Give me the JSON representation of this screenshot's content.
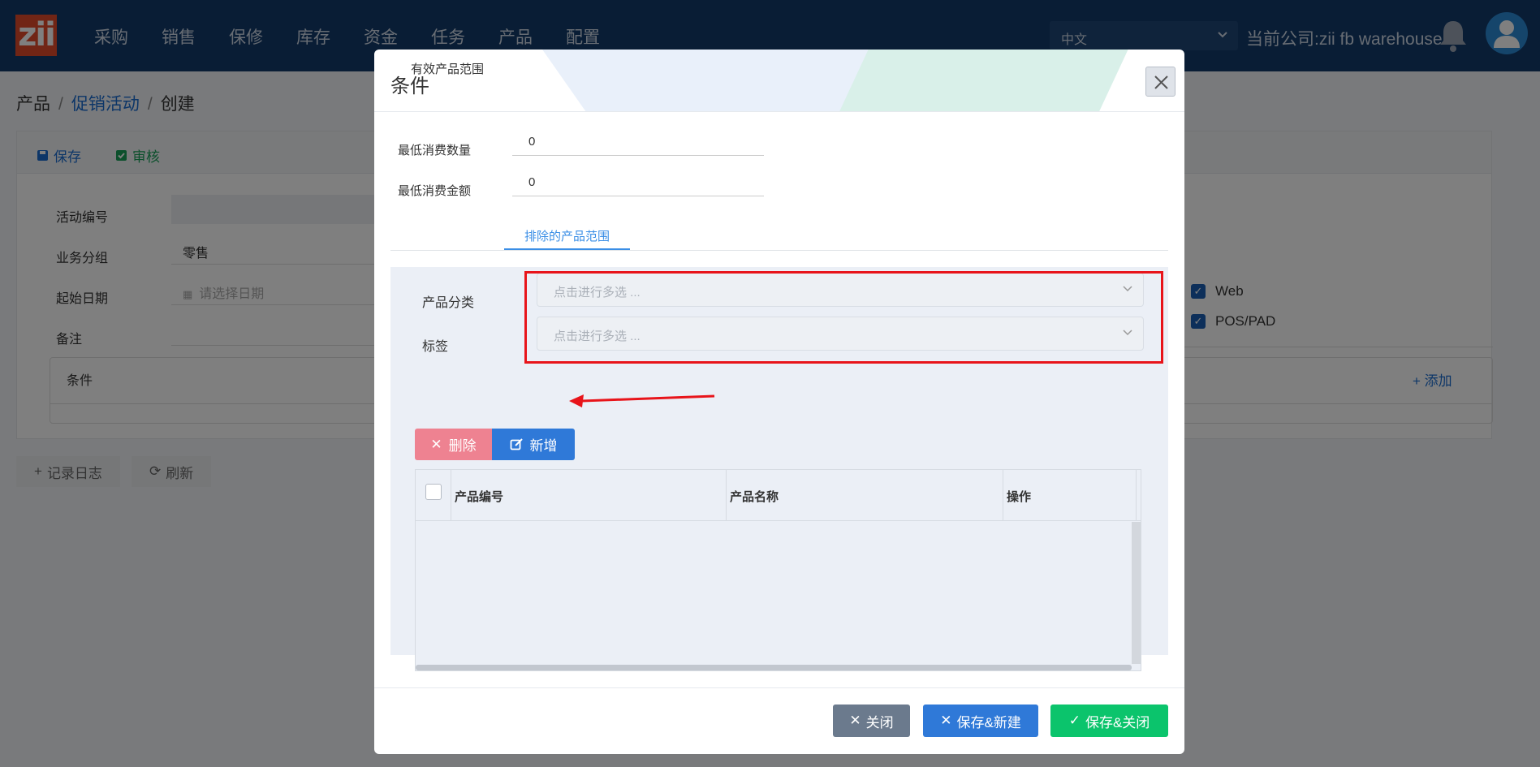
{
  "topbar": {
    "logo_text": "zii",
    "menu": [
      "采购",
      "销售",
      "保修",
      "库存",
      "资金",
      "任务",
      "产品",
      "配置"
    ],
    "language": "中文",
    "company": "当前公司:zii fb warehouse"
  },
  "page": {
    "breadcrumb": [
      "产品",
      "促销活动",
      "创建"
    ],
    "toolbar": {
      "save": "保存",
      "review": "审核"
    },
    "fields": {
      "activity_no_label": "活动编号",
      "group_label": "业务分组",
      "group_value": "零售",
      "start_date_label": "起始日期",
      "start_date_placeholder": "请选择日期",
      "remark_label": "备注"
    },
    "conditions_label": "条件",
    "add_label": "添加",
    "channels": [
      "Web",
      "POS/PAD"
    ],
    "log_button": "记录日志",
    "refresh_button": "刷新"
  },
  "modal": {
    "title": "条件",
    "min_qty_label": "最低消费数量",
    "min_qty_value": "0",
    "min_amount_label": "最低消费金额",
    "min_amount_value": "0",
    "tabs": [
      "有效产品范围",
      "排除的产品范围"
    ],
    "active_tab": 1,
    "category_label": "产品分类",
    "category_placeholder": "点击进行多选 ...",
    "tag_label": "标签",
    "tag_placeholder": "点击进行多选 ...",
    "delete_button": "删除",
    "add_button": "新增",
    "columns": [
      "产品编号",
      "产品名称",
      "操作"
    ],
    "footer": {
      "close": "关闭",
      "save_new": "保存&新建",
      "save_close": "保存&关闭"
    }
  },
  "colors": {
    "topbar": "#123a6b",
    "primary": "#2f79d8",
    "danger": "#ee8291",
    "success": "#0bc46c",
    "highlight": "#e8141a"
  }
}
